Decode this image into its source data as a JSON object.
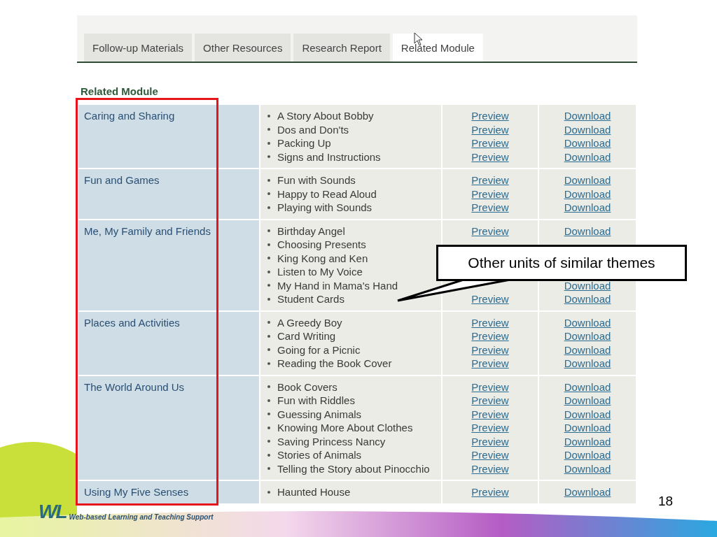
{
  "tabs": [
    {
      "label": "Follow-up Materials",
      "selected": false
    },
    {
      "label": "Other Resources",
      "selected": false
    },
    {
      "label": "Research Report",
      "selected": false
    },
    {
      "label": "Related Module",
      "selected": true
    }
  ],
  "section_title": "Related Module",
  "modules": [
    {
      "theme": "Caring and Sharing",
      "units": [
        {
          "title": "A Story About Bobby",
          "preview": "Preview",
          "download": "Download"
        },
        {
          "title": "Dos and Don'ts",
          "preview": "Preview",
          "download": "Download"
        },
        {
          "title": "Packing Up",
          "preview": "Preview",
          "download": "Download"
        },
        {
          "title": "Signs and Instructions",
          "preview": "Preview",
          "download": "Download"
        }
      ]
    },
    {
      "theme": "Fun and Games",
      "units": [
        {
          "title": "Fun with Sounds",
          "preview": "Preview",
          "download": "Download"
        },
        {
          "title": "Happy to Read Aloud",
          "preview": "Preview",
          "download": "Download"
        },
        {
          "title": "Playing with Sounds",
          "preview": "Preview",
          "download": "Download"
        }
      ]
    },
    {
      "theme": "Me, My Family and Friends",
      "units": [
        {
          "title": "Birthday Angel",
          "preview": "Preview",
          "download": "Download"
        },
        {
          "title": "Choosing Presents"
        },
        {
          "title": "King Kong and Ken"
        },
        {
          "title": "Listen to My Voice"
        },
        {
          "title": "My Hand in Mama's Hand",
          "download": "Download"
        },
        {
          "title": "Student Cards",
          "preview": "Preview",
          "download": "Download"
        }
      ]
    },
    {
      "theme": "Places and Activities",
      "units": [
        {
          "title": "A Greedy Boy",
          "preview": "Preview",
          "download": "Download"
        },
        {
          "title": "Card Writing",
          "preview": "Preview",
          "download": "Download"
        },
        {
          "title": "Going for a Picnic",
          "preview": "Preview",
          "download": "Download"
        },
        {
          "title": "Reading the Book Cover",
          "preview": "Preview",
          "download": "Download"
        }
      ]
    },
    {
      "theme": "The World Around Us",
      "units": [
        {
          "title": "Book Covers",
          "preview": "Preview",
          "download": "Download"
        },
        {
          "title": "Fun with Riddles",
          "preview": "Preview",
          "download": "Download"
        },
        {
          "title": "Guessing Animals",
          "preview": "Preview",
          "download": "Download"
        },
        {
          "title": "Knowing More About Clothes",
          "preview": "Preview",
          "download": "Download"
        },
        {
          "title": "Saving Princess Nancy",
          "preview": "Preview",
          "download": "Download"
        },
        {
          "title": "Stories of Animals",
          "preview": "Preview",
          "download": "Download"
        },
        {
          "title": "Telling the Story about Pinocchio",
          "preview": "Preview",
          "download": "Download"
        }
      ]
    },
    {
      "theme": "Using My Five Senses",
      "units": [
        {
          "title": "Haunted House",
          "preview": "Preview",
          "download": "Download"
        }
      ]
    }
  ],
  "callout": {
    "text": "Other units of similar themes"
  },
  "page_number": "18",
  "footer": {
    "logo": "WL",
    "tagline": "Web-based Learning and Teaching Support"
  }
}
